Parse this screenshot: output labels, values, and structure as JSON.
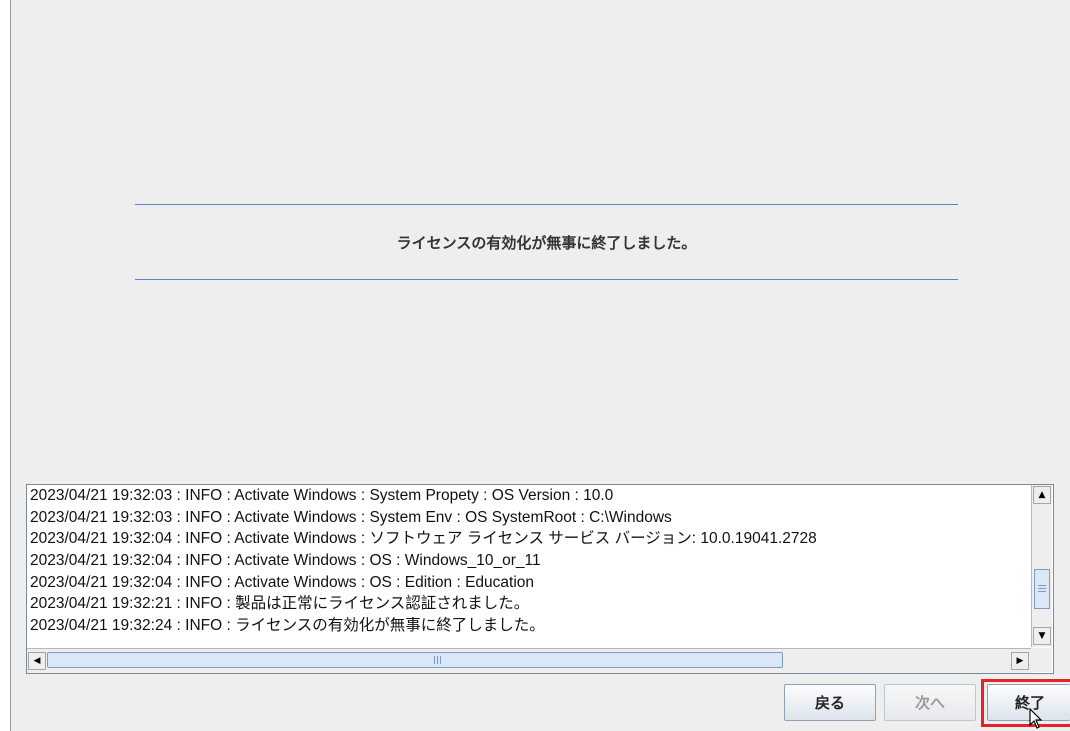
{
  "message": "ライセンスの有効化が無事に終了しました。",
  "log": [
    "2023/04/21 19:32:03 : INFO  : Activate Windows : System Propety : OS Version : 10.0",
    "2023/04/21 19:32:03 : INFO  : Activate Windows : System Env : OS SystemRoot : C:\\Windows",
    "2023/04/21 19:32:04 : INFO  : Activate Windows : ソフトウェア ライセンス サービス バージョン: 10.0.19041.2728",
    "2023/04/21 19:32:04 : INFO  : Activate Windows : OS : Windows_10_or_11",
    "2023/04/21 19:32:04 : INFO  : Activate Windows : OS : Edition : Education",
    "2023/04/21 19:32:21 : INFO  : 製品は正常にライセンス認証されました。",
    "2023/04/21 19:32:24 : INFO  : ライセンスの有効化が無事に終了しました。"
  ],
  "buttons": {
    "back": "戻る",
    "next": "次へ",
    "finish": "終了"
  },
  "colors": {
    "accent_line": "#5b84c4",
    "highlight": "#e6232b"
  },
  "icons": {
    "scroll_up": "triangle-up-icon",
    "scroll_down": "triangle-down-icon",
    "scroll_left": "triangle-left-icon",
    "scroll_right": "triangle-right-icon",
    "cursor": "mouse-pointer-icon"
  }
}
